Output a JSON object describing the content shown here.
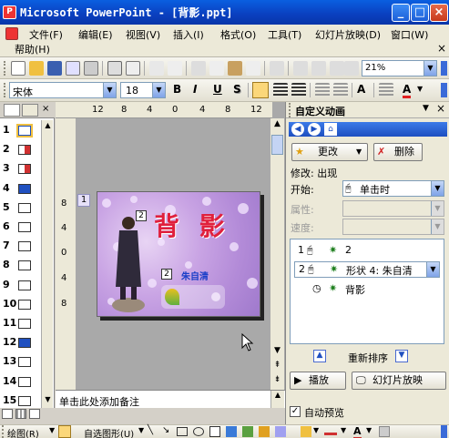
{
  "window": {
    "title": "Microsoft PowerPoint - [背影.ppt]"
  },
  "menu": {
    "items": [
      "文件(F)",
      "编辑(E)",
      "视图(V)",
      "插入(I)",
      "格式(O)",
      "工具(T)",
      "幻灯片放映(D)",
      "窗口(W)",
      "帮助(H)"
    ],
    "close_glyph": "×"
  },
  "format_toolbar": {
    "zoom": "21%",
    "font_name": "宋体",
    "font_size": "18",
    "bold": "B",
    "italic": "I",
    "underline": "U",
    "shadow": "S",
    "grow_font": "A",
    "font_color": "A"
  },
  "ruler": {
    "top_ticks": [
      "12",
      "8",
      "4",
      "0",
      "4",
      "8",
      "12"
    ],
    "left_ticks": [
      "8",
      "4",
      "0",
      "4",
      "8"
    ]
  },
  "slides_pane": {
    "numbers": [
      "1",
      "2",
      "3",
      "4",
      "5",
      "6",
      "7",
      "8",
      "9",
      "10",
      "11",
      "12",
      "13",
      "14",
      "15"
    ]
  },
  "slide": {
    "number_badge": "1",
    "title": "背 影",
    "author": "朱自清",
    "tag_title": "2",
    "tag_author": "2"
  },
  "notes": {
    "placeholder": "单击此处添加备注"
  },
  "task_pane": {
    "title": "自定义动画",
    "change_button": "更改",
    "delete_button": "删除",
    "modify_label": "修改: 出现",
    "start_label": "开始:",
    "start_value": "单击时",
    "property_label": "属性:",
    "speed_label": "速度:",
    "anim_items": [
      {
        "index": "1",
        "name": "2"
      },
      {
        "index": "2",
        "name": "形状 4: 朱自清"
      },
      {
        "index": "",
        "name": "背影"
      }
    ],
    "reorder_label": "重新排序",
    "play_button": "播放",
    "slideshow_button": "幻灯片放映",
    "autopreview_label": "自动预览",
    "autopreview_checked": true
  },
  "draw_toolbar": {
    "draw_label": "绘图(R)",
    "autoshape_label": "自选图形(U)"
  },
  "colors": {
    "title_bar": "#0a3fbf",
    "accent_blue": "#1d5fd8",
    "close_red": "#c73a1c",
    "panel_bg": "#ece9d8",
    "slide_title_red": "#e0203c",
    "slide_title_blue": "#2a6de8"
  }
}
